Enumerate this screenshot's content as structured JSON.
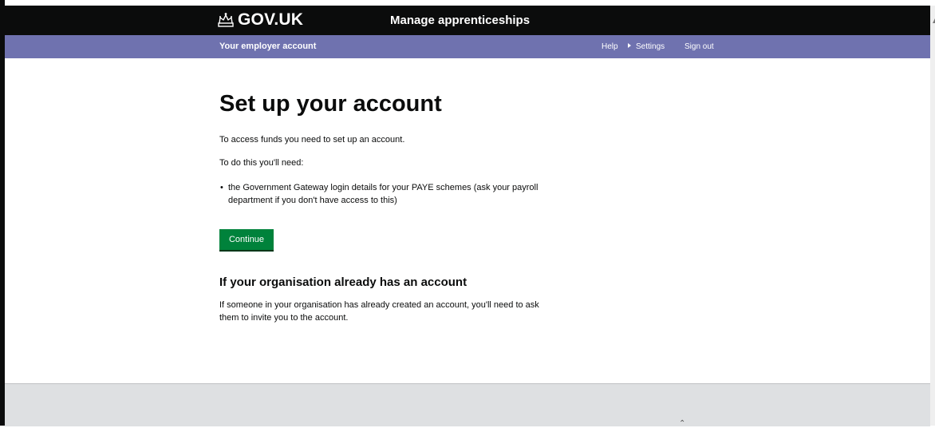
{
  "header": {
    "logo_text": "GOV.UK",
    "service_name": "Manage apprenticeships"
  },
  "account_bar": {
    "account_label": "Your employer account",
    "nav": [
      {
        "label": "Help"
      },
      {
        "label": "Settings"
      },
      {
        "label": "Sign out"
      }
    ]
  },
  "main": {
    "title": "Set up your account",
    "intro": "To access funds you need to set up an account.",
    "need_label": "To do this you'll need:",
    "bullets": [
      "the Government Gateway login details for your PAYE schemes (ask your payroll department if you don't have access to this)"
    ],
    "continue_label": "Continue",
    "subheading": "If your organisation already has an account",
    "subtext": "If someone in your organisation has already created an account, you'll need to ask them to invite you to the account."
  },
  "colors": {
    "header_bg": "#0b0c0c",
    "account_bar_bg": "#6f72af",
    "button_green": "#00823b",
    "footer_bg": "#dee0e2"
  }
}
